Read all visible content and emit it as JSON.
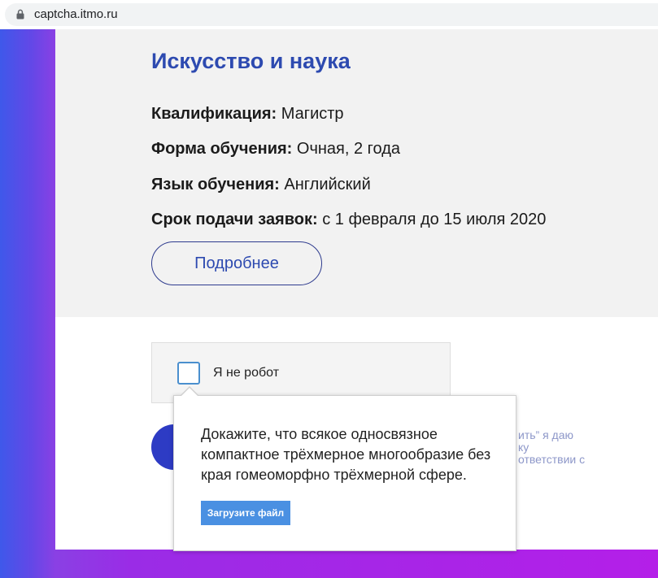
{
  "browser": {
    "url": "captcha.itmo.ru",
    "security_icon": "lock-icon"
  },
  "program": {
    "title": "Искусство и наука",
    "details": [
      {
        "label": "Квалификация:",
        "value": "Магистр"
      },
      {
        "label": "Форма обучения:",
        "value": "Очная, 2 года"
      },
      {
        "label": "Язык обучения:",
        "value": "Английский"
      },
      {
        "label": "Срок подачи заявок:",
        "value": "с 1 февраля до 15 июля 2020"
      }
    ],
    "more_button_label": "Подробнее"
  },
  "captcha": {
    "checkbox_label": "Я не робот",
    "checked": false,
    "challenge": {
      "text_lines": [
        "Докажите, что всякое односвязное",
        "компактное трёхмерное многообразие без",
        "края гомеоморфно трёхмерной сфере."
      ],
      "upload_button_label": "Загрузите файл"
    }
  },
  "consent": {
    "visible_lines": [
      "ить” я даю",
      "ку",
      "ответствии с"
    ]
  },
  "theme": {
    "accent": "#2d4ab0",
    "outline_button_border": "#2e3b8e",
    "upload_button": "#4a90e2",
    "submit_button": "#2d3bc4",
    "card_background": "#f2f2f2",
    "checkbox_border": "#4a8fce",
    "consent_text": "#8d97c9",
    "gradient_start": "#3f58ea",
    "gradient_mid": "#9a2ce6",
    "gradient_end": "#b41fe8"
  }
}
